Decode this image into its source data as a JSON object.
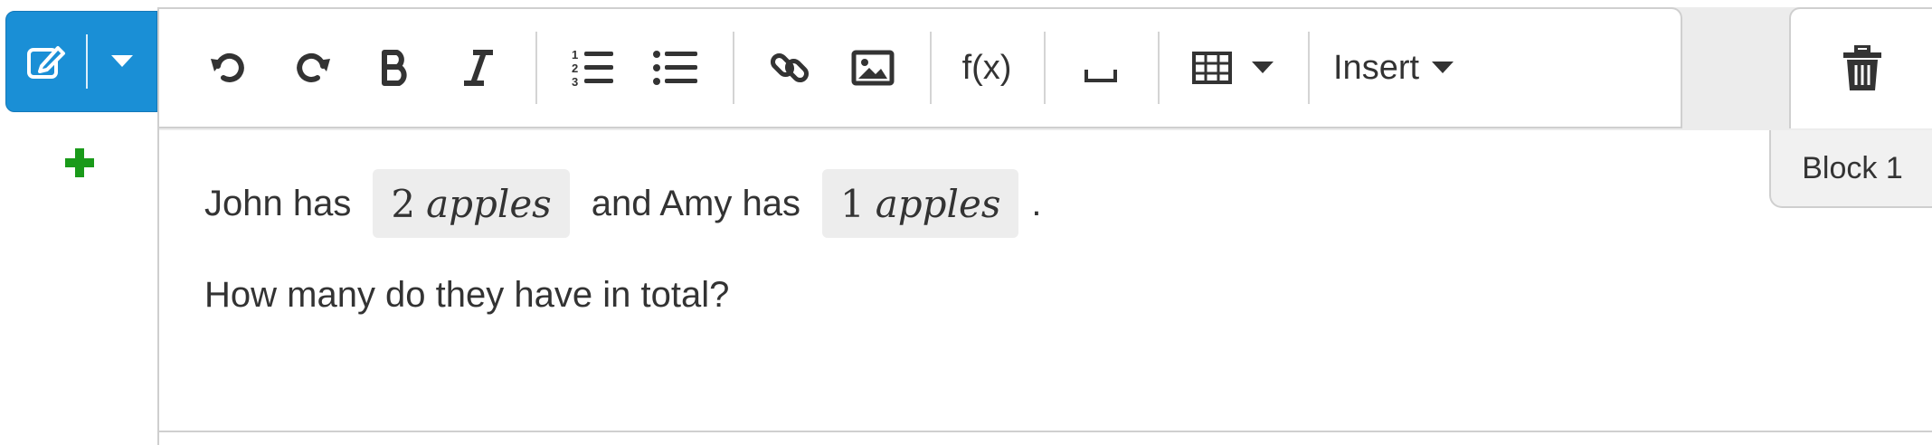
{
  "editor": {
    "edit_button": {
      "icon": "pencil-square-icon",
      "caret_icon": "caret-down-icon",
      "color": "#1a8fd6"
    },
    "add_button": {
      "icon": "plus-icon",
      "color": "#1a9a1a"
    },
    "toolbar": {
      "buttons": [
        {
          "name": "undo",
          "icon": "undo-icon"
        },
        {
          "name": "redo",
          "icon": "redo-icon"
        },
        {
          "name": "bold",
          "icon": "bold-icon"
        },
        {
          "name": "italic",
          "icon": "italic-icon"
        },
        {
          "name": "ordered-list",
          "icon": "ordered-list-icon"
        },
        {
          "name": "unordered-list",
          "icon": "unordered-list-icon"
        },
        {
          "name": "link",
          "icon": "link-icon"
        },
        {
          "name": "image",
          "icon": "image-icon"
        },
        {
          "name": "formula",
          "label": "f(x)"
        },
        {
          "name": "blank",
          "icon": "blank-space-icon"
        },
        {
          "name": "table",
          "icon": "table-icon"
        }
      ],
      "insert_label": "Insert"
    },
    "delete_icon": "trash-icon",
    "block_label": "Block 1"
  },
  "content": {
    "line1": {
      "before": "John has",
      "chip1": {
        "number": "2",
        "variable": "apples"
      },
      "middle": "and Amy has",
      "chip2": {
        "number": "1",
        "variable": "apples"
      },
      "after": "."
    },
    "line2": "How many do they have in total?"
  }
}
